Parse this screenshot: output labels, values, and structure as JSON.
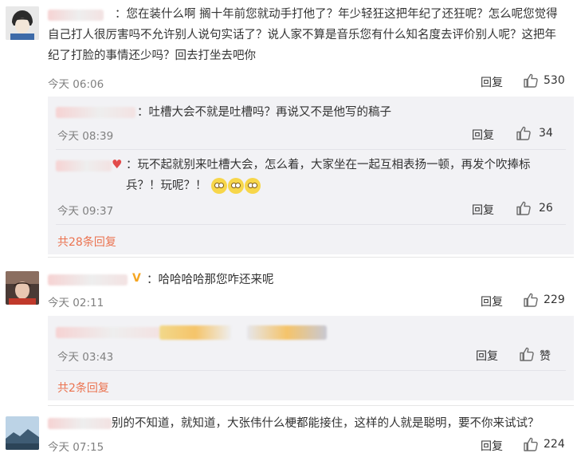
{
  "comments": [
    {
      "text": "：您在装什么啊 搁十年前您就动手打他了？年少轻狂这把年纪了还狂呢？怎么呢您觉得自己打人很厉害吗不允许别人说句实话了？说人家不算是音乐您有什么知名度去评价别人呢？这把年纪了打脸的事情还少吗？回去打坐去吧你",
      "time": "今天 06:06",
      "reply_label": "回复",
      "likes": "530",
      "replies": [
        {
          "text": "：吐槽大会不就是吐槽吗？再说又不是他写的稿子",
          "time": "今天 08:39",
          "reply_label": "回复",
          "likes": "34"
        },
        {
          "text": "：玩不起就别来吐槽大会，怎么着，大家坐在一起互相表扬一顿，再发个吹捧标兵？！玩呢？！",
          "time": "今天 09:37",
          "reply_label": "回复",
          "likes": "26"
        }
      ],
      "more_replies": "共28条回复"
    },
    {
      "text": "：哈哈哈哈那您咋还来呢",
      "time": "今天 02:11",
      "reply_label": "回复",
      "likes": "229",
      "replies": [
        {
          "text": "",
          "time": "今天 03:43",
          "reply_label": "回复",
          "likes": "赞"
        }
      ],
      "more_replies": "共2条回复"
    },
    {
      "text": "别的不知道，就知道，大张伟什么梗都能接住，这样的人就是聪明，要不你来试试？",
      "time": "今天 07:15",
      "reply_label": "回复",
      "likes": "224"
    }
  ],
  "colors": {
    "accent": "#eb7350",
    "reply_bg": "#f2f2f5",
    "muted": "#808080"
  },
  "icons": {
    "like": "thumbs-up-icon",
    "emoji": "rolling-eyes-emoji",
    "verified": "verified-v-icon"
  }
}
